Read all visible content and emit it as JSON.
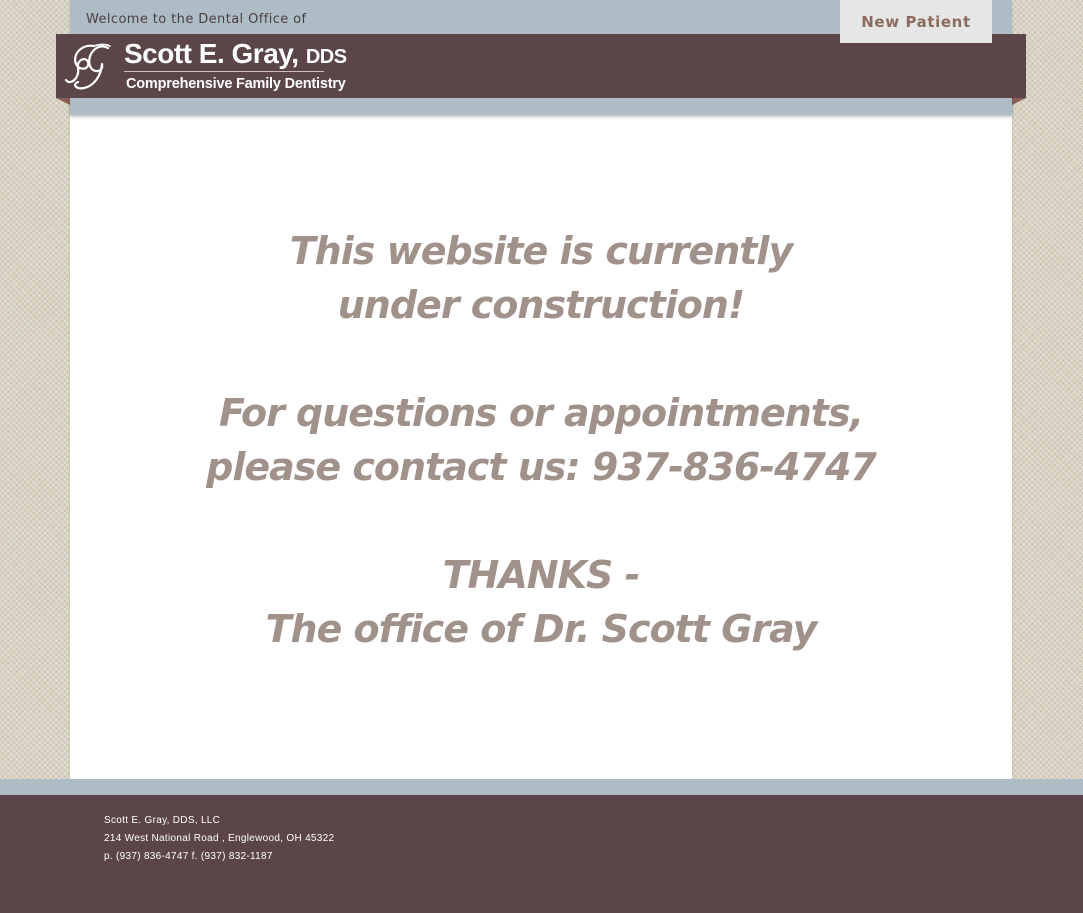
{
  "header": {
    "welcome": "Welcome to the Dental Office of",
    "new_patient_label": "New Patient",
    "brand": {
      "name": "Scott E. Gray,",
      "suffix": "DDS",
      "tagline": "Comprehensive Family Dentistry",
      "logo_icon": "sg-monogram-icon"
    }
  },
  "main": {
    "line1": "This website is currently",
    "line2": "under construction!",
    "line3": "For questions or appointments,",
    "line4": "please contact us: 937-836-4747",
    "line5": "THANKS -",
    "line6": "The office of Dr. Scott Gray"
  },
  "footer": {
    "company": "Scott E. Gray, DDS, LLC",
    "address": "214 West National Road , Englewood, OH 45322",
    "phones": "p. (937) 836-4747 f. (937) 832-1187"
  },
  "colors": {
    "brand_band": "#5b4548",
    "steel_blue": "#aebcc5",
    "message_text": "#a1918b",
    "new_patient_text": "#8c6b5f",
    "background_texture": "#d8d2c2"
  }
}
